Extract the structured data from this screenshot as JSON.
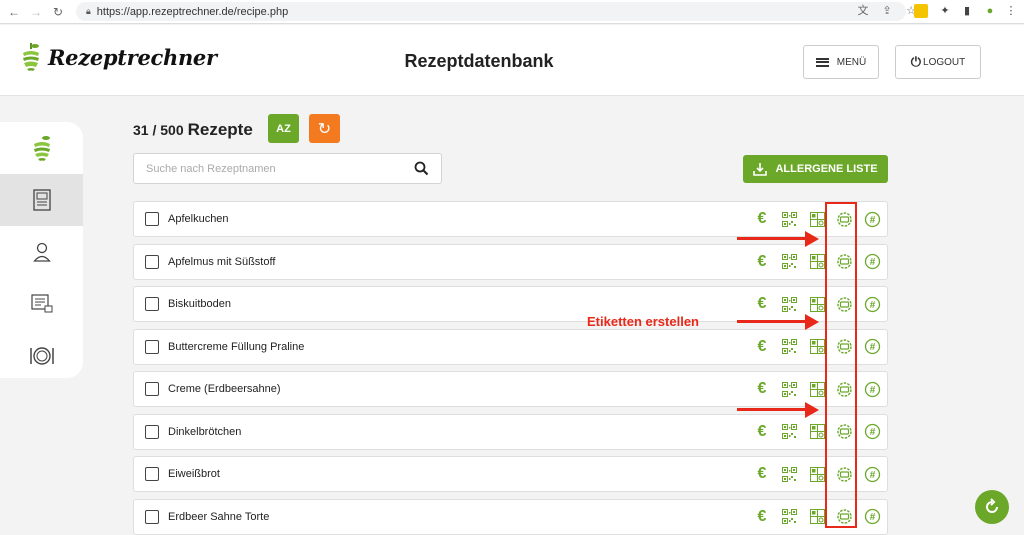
{
  "browser": {
    "url": "https://app.rezeptrechner.de/recipe.php"
  },
  "header": {
    "logo_text": "Rezeptrechner",
    "title": "Rezeptdatenbank",
    "menu_label": "MENÜ",
    "logout_label": "LOGOUT"
  },
  "sidebar": {
    "items": [
      {
        "icon": "apple-logo-icon"
      },
      {
        "icon": "recipe-card-icon",
        "active": true
      },
      {
        "icon": "user-icon"
      },
      {
        "icon": "list-lock-icon"
      },
      {
        "icon": "plate-cutlery-icon"
      }
    ]
  },
  "toolbar": {
    "count": "31 / 500",
    "count_word": "Rezepte",
    "sort_label": "AZ",
    "search_placeholder": "Suche nach Rezeptnamen",
    "allergen_label": "ALLERGENE LISTE"
  },
  "recipes": [
    {
      "name": "Apfelkuchen"
    },
    {
      "name": "Apfelmus mit Süßstoff"
    },
    {
      "name": "Biskuitboden"
    },
    {
      "name": "Buttercreme Füllung Praline"
    },
    {
      "name": "Creme (Erdbeersahne)"
    },
    {
      "name": "Dinkelbrötchen"
    },
    {
      "name": "Eiweißbrot"
    },
    {
      "name": "Erdbeer Sahne Torte"
    }
  ],
  "row_icons": [
    "euro-icon",
    "qr-code-icon",
    "nutrition-table-icon",
    "label-seal-icon",
    "hashtag-icon"
  ],
  "annotation": {
    "label": "Etiketten erstellen",
    "color": "#e8291a"
  },
  "colors": {
    "brand_green": "#6ba82a",
    "orange": "#f47a20"
  }
}
